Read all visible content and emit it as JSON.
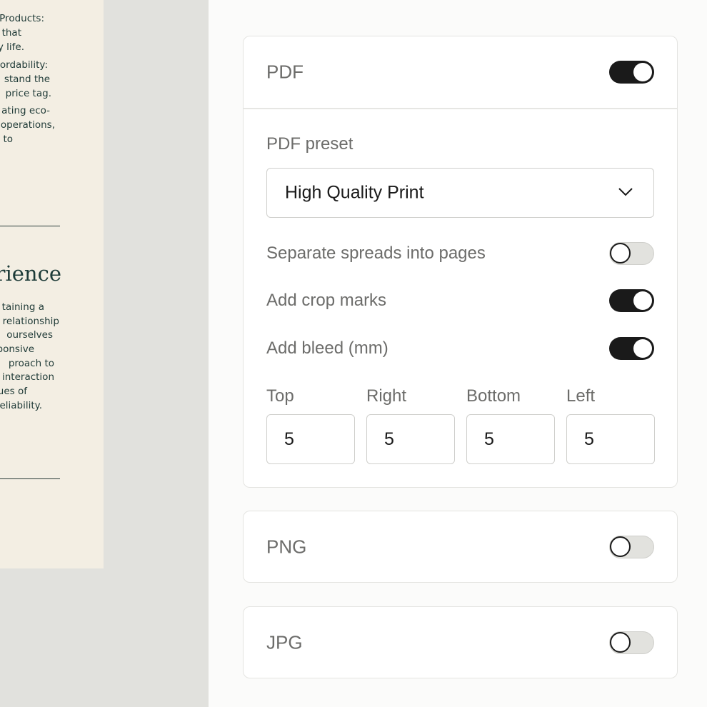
{
  "document_preview": {
    "text_block_1": [
      "Products:",
      "that",
      "y life.",
      "ordability:",
      "stand the",
      "price tag.",
      "ating eco-",
      "operations,",
      "to"
    ],
    "heading": "erience",
    "text_block_2": [
      "taining a",
      "relationship",
      "ourselves",
      "ponsive",
      "proach to",
      "interaction",
      "ues of",
      "eliability."
    ]
  },
  "export": {
    "pdf": {
      "label": "PDF",
      "enabled": true,
      "preset_label": "PDF preset",
      "preset_value": "High Quality Print",
      "separate_spreads_label": "Separate spreads into pages",
      "separate_spreads": false,
      "crop_marks_label": "Add crop marks",
      "crop_marks": true,
      "bleed_label": "Add bleed (mm)",
      "bleed": true,
      "bleed_fields": {
        "top_label": "Top",
        "top_value": "5",
        "right_label": "Right",
        "right_value": "5",
        "bottom_label": "Bottom",
        "bottom_value": "5",
        "left_label": "Left",
        "left_value": "5"
      }
    },
    "png": {
      "label": "PNG",
      "enabled": false
    },
    "jpg": {
      "label": "JPG",
      "enabled": false
    }
  },
  "icons": {
    "select_chevron": "chevron-down-icon"
  },
  "colors": {
    "toggle_on": "#1a1a1a",
    "toggle_off": "#e2e2de",
    "page_bg": "#f3eee3",
    "canvas_bg": "#e1e1dd"
  }
}
